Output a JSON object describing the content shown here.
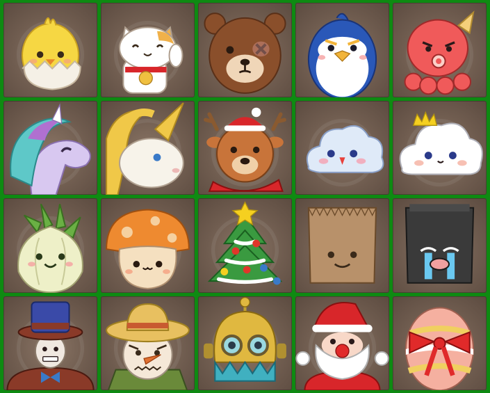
{
  "board": {
    "rows": 4,
    "columns": 5,
    "tiles": [
      {
        "character": "chick-in-egg",
        "icon": "chick-icon",
        "colors": [
          "#f6d743",
          "#f5f0e6"
        ]
      },
      {
        "character": "lucky-cat",
        "icon": "lucky-cat-icon",
        "colors": [
          "#ffffff",
          "#f0b14a",
          "#d8262a"
        ]
      },
      {
        "character": "brown-bear",
        "icon": "bear-icon",
        "colors": [
          "#8a4f2b",
          "#f0d6b8"
        ]
      },
      {
        "character": "penguin",
        "icon": "penguin-icon",
        "colors": [
          "#2a58b8",
          "#ffffff",
          "#f2b43a"
        ]
      },
      {
        "character": "octopus-with-cone",
        "icon": "octopus-icon",
        "colors": [
          "#f05a5a",
          "#f5d07a"
        ]
      },
      {
        "character": "pastel-unicorn-pony",
        "icon": "pony-icon",
        "colors": [
          "#d8c8f0",
          "#5ec8c8",
          "#b070d0"
        ]
      },
      {
        "character": "golden-unicorn",
        "icon": "unicorn-icon",
        "colors": [
          "#f7f3ea",
          "#f0c848"
        ]
      },
      {
        "character": "christmas-reindeer",
        "icon": "reindeer-icon",
        "colors": [
          "#c8743a",
          "#d8262a"
        ]
      },
      {
        "character": "cloud-bird",
        "icon": "cloud-icon",
        "colors": [
          "#dfeaf8",
          "#e8403a"
        ]
      },
      {
        "character": "crowned-cloud",
        "icon": "crown-cloud-icon",
        "colors": [
          "#ffffff",
          "#f5d020"
        ]
      },
      {
        "character": "onion-sprout",
        "icon": "onion-icon",
        "colors": [
          "#eef0c8",
          "#6ab044"
        ]
      },
      {
        "character": "orange-mushroom",
        "icon": "mushroom-icon",
        "colors": [
          "#ee8a30",
          "#f5e0c0"
        ]
      },
      {
        "character": "christmas-tree",
        "icon": "christmas-tree-icon",
        "colors": [
          "#3a9a40",
          "#f5d020",
          "#e0362a"
        ]
      },
      {
        "character": "paper-bag",
        "icon": "paper-bag-icon",
        "colors": [
          "#b8916a"
        ]
      },
      {
        "character": "crying-black-bag",
        "icon": "crying-bag-icon",
        "colors": [
          "#3a3a3a",
          "#6ac8f0"
        ]
      },
      {
        "character": "top-hat-gentleman",
        "icon": "top-hat-icon",
        "colors": [
          "#3a4aa8",
          "#8a3a28",
          "#f0e8e0"
        ]
      },
      {
        "character": "scarecrow",
        "icon": "scarecrow-icon",
        "colors": [
          "#e8c060",
          "#f5e8d8",
          "#e07030"
        ]
      },
      {
        "character": "diving-robot",
        "icon": "robot-icon",
        "colors": [
          "#e0b840",
          "#40b0c0"
        ]
      },
      {
        "character": "santa-claus",
        "icon": "santa-icon",
        "colors": [
          "#d8262a",
          "#ffffff"
        ]
      },
      {
        "character": "easter-egg-with-bow",
        "icon": "easter-egg-icon",
        "colors": [
          "#f5b0a0",
          "#f0d060",
          "#e02a2a"
        ]
      }
    ]
  }
}
